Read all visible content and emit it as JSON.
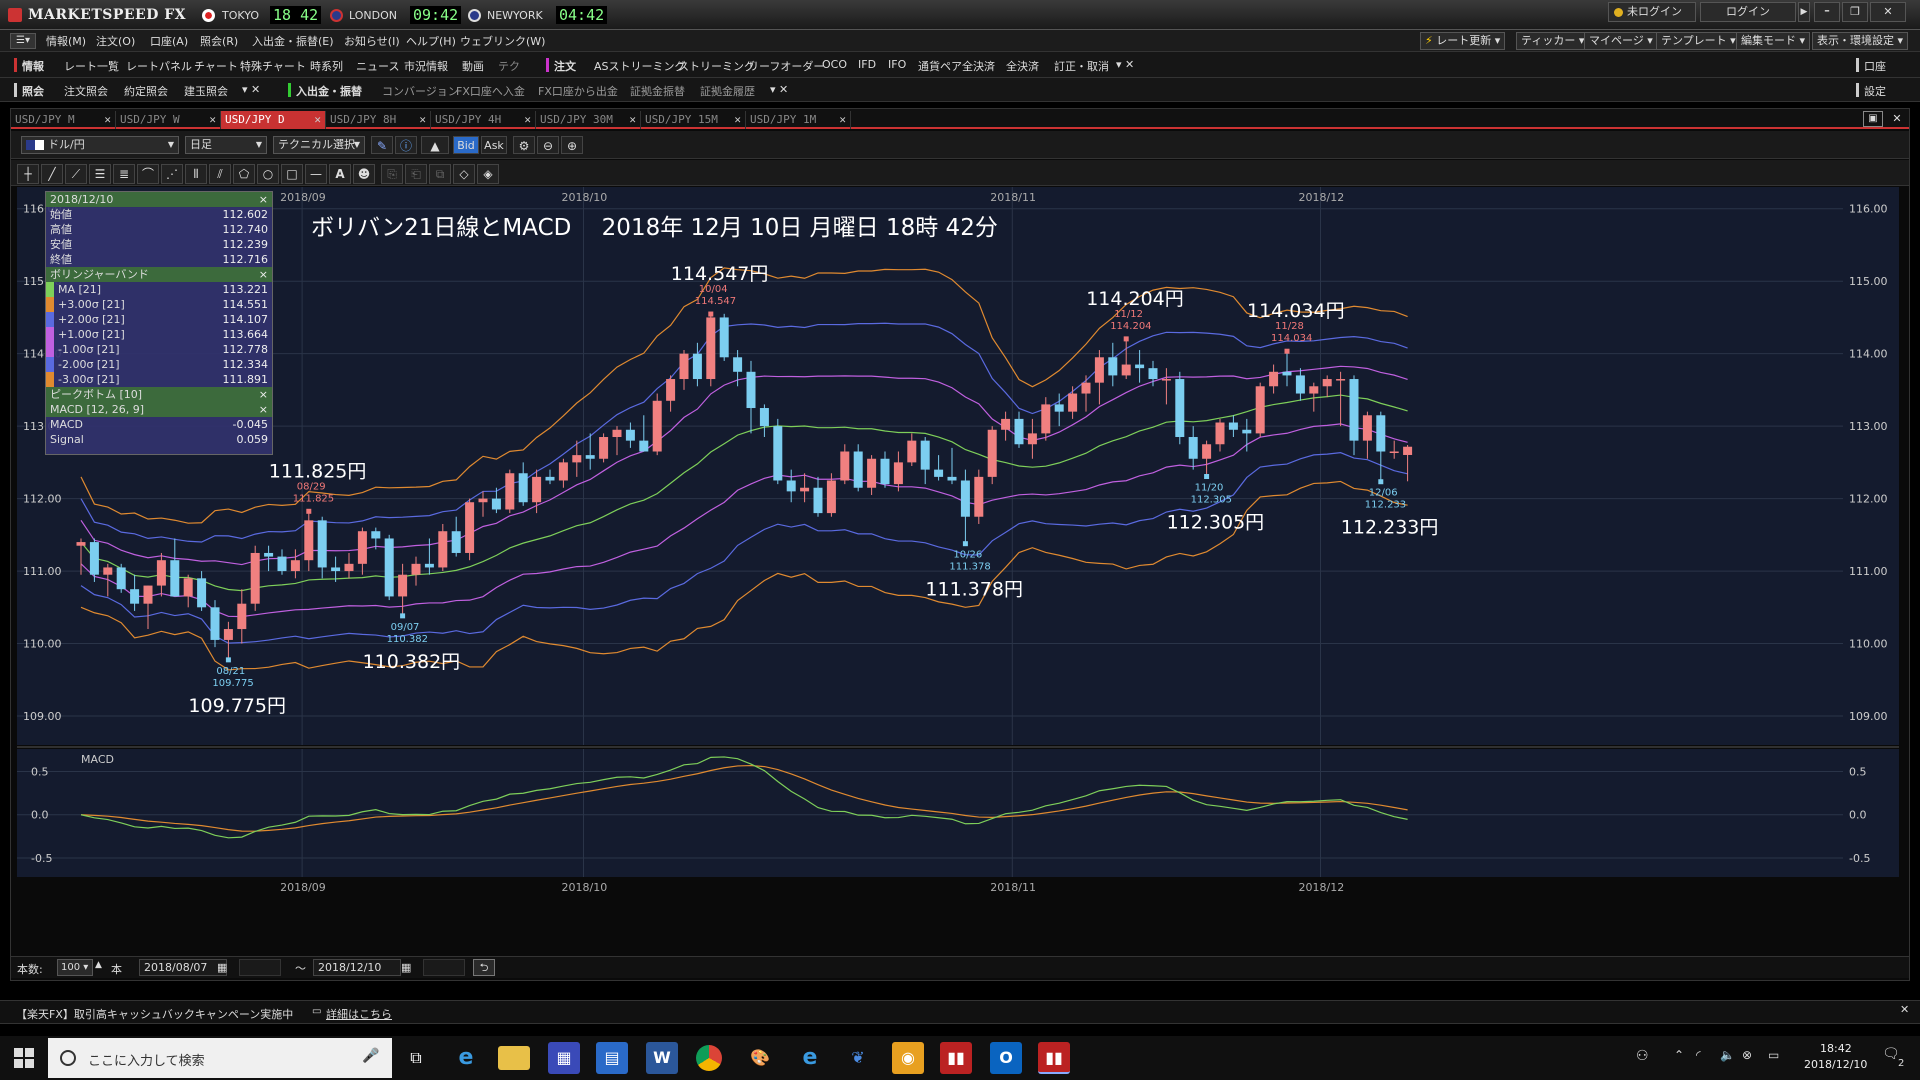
{
  "app": {
    "title": "MARKETSPEED FX",
    "clocks": [
      {
        "city": "TOKYO",
        "time": "18 42"
      },
      {
        "city": "LONDON",
        "time": "09:42"
      },
      {
        "city": "NEWYORK",
        "time": "04:42"
      }
    ],
    "login_status": "未ログイン",
    "login_button": "ログイン"
  },
  "menubar": {
    "items": [
      "情報(M)",
      "注文(O)",
      "口座(A)",
      "照会(R)",
      "入出金・振替(E)",
      "お知らせ(I)",
      "ヘルプ(H)",
      "ウェブリンク(W)"
    ],
    "right_items": [
      "レート更新",
      "ティッカー",
      "マイページ",
      "テンプレート",
      "編集モード",
      "表示・環境設定"
    ]
  },
  "toolbar1": {
    "left_label": "情報",
    "items": [
      "レート一覧",
      "レートパネル",
      "チャート",
      "特殊チャート",
      "時系列",
      "ニュース",
      "市況情報",
      "動画",
      "テク"
    ],
    "order_label": "注文",
    "order_items": [
      "ASストリーミング",
      "ストリーミング",
      "リーフオーダー",
      "OCO",
      "IFD",
      "IFO",
      "通貨ペア全決済",
      "全決済",
      "訂正・取消"
    ],
    "right_label": "口座"
  },
  "toolbar2": {
    "left_label": "照会",
    "items": [
      "注文照会",
      "約定照会",
      "建玉照会"
    ],
    "transfer_label": "入出金・振替",
    "transfer_items": [
      "コンバージョン",
      "FX口座へ入金",
      "FX口座から出金",
      "証拠金振替",
      "証拠金履歴"
    ],
    "right_label": "設定"
  },
  "tabs": [
    "USD/JPY M",
    "USD/JPY W",
    "USD/JPY D",
    "USD/JPY 8H",
    "USD/JPY 4H",
    "USD/JPY 30M",
    "USD/JPY 15M",
    "USD/JPY 1M"
  ],
  "active_tab": 2,
  "controls": {
    "pair": "ドル/円",
    "period": "日足",
    "technical": "テクニカル選択",
    "bid": "Bid",
    "ask": "Ask"
  },
  "info_panel": {
    "date": "2018/12/10",
    "ohlc": [
      {
        "label": "始値",
        "value": "112.602"
      },
      {
        "label": "高値",
        "value": "112.740"
      },
      {
        "label": "安値",
        "value": "112.239"
      },
      {
        "label": "終値",
        "value": "112.716"
      }
    ],
    "bb_title": "ボリンジャーバンド",
    "bb": [
      {
        "label": "MA [21]",
        "value": "113.221"
      },
      {
        "label": "+3.00σ [21]",
        "value": "114.551"
      },
      {
        "label": "+2.00σ [21]",
        "value": "114.107"
      },
      {
        "label": "+1.00σ [21]",
        "value": "113.664"
      },
      {
        "label": "-1.00σ [21]",
        "value": "112.778"
      },
      {
        "label": "-2.00σ [21]",
        "value": "112.334"
      },
      {
        "label": "-3.00σ [21]",
        "value": "111.891"
      }
    ],
    "peak_title": "ピークボトム [10]",
    "macd_title": "MACD [12, 26, 9]",
    "macd": [
      {
        "label": "MACD",
        "value": "-0.045"
      },
      {
        "label": "Signal",
        "value": "0.059"
      }
    ]
  },
  "chart_data": {
    "type": "candlestick",
    "title": "ボリバン21日線とMACD　 2018年 12月 10日 月曜日 18時 42分",
    "month_labels": [
      "2018/09",
      "2018/10",
      "2018/11",
      "2018/12"
    ],
    "y_ticks": [
      "116.00",
      "115.00",
      "114.00",
      "113.00",
      "112.00",
      "111.00",
      "110.00",
      "109.00"
    ],
    "ylim": [
      108.6,
      116.3
    ],
    "macd_label": "MACD",
    "macd_ticks": [
      "0.5",
      "0.0",
      "-0.5"
    ],
    "candles": [
      {
        "o": 111.35,
        "h": 111.45,
        "l": 110.95,
        "c": 111.4
      },
      {
        "o": 111.4,
        "h": 111.45,
        "l": 110.85,
        "c": 110.95
      },
      {
        "o": 110.95,
        "h": 111.1,
        "l": 110.65,
        "c": 111.05
      },
      {
        "o": 111.05,
        "h": 111.1,
        "l": 110.7,
        "c": 110.75
      },
      {
        "o": 110.75,
        "h": 110.95,
        "l": 110.45,
        "c": 110.55
      },
      {
        "o": 110.55,
        "h": 110.8,
        "l": 110.2,
        "c": 110.8
      },
      {
        "o": 110.8,
        "h": 111.25,
        "l": 110.65,
        "c": 111.15
      },
      {
        "o": 111.15,
        "h": 111.45,
        "l": 110.8,
        "c": 110.65
      },
      {
        "o": 110.65,
        "h": 110.95,
        "l": 110.5,
        "c": 110.9
      },
      {
        "o": 110.9,
        "h": 111.0,
        "l": 110.45,
        "c": 110.5
      },
      {
        "o": 110.5,
        "h": 110.6,
        "l": 109.95,
        "c": 110.05
      },
      {
        "o": 110.05,
        "h": 110.3,
        "l": 109.775,
        "c": 110.2
      },
      {
        "o": 110.2,
        "h": 110.75,
        "l": 110.0,
        "c": 110.55
      },
      {
        "o": 110.55,
        "h": 111.35,
        "l": 110.45,
        "c": 111.25
      },
      {
        "o": 111.25,
        "h": 111.35,
        "l": 111.0,
        "c": 111.2
      },
      {
        "o": 111.2,
        "h": 111.3,
        "l": 110.95,
        "c": 111.0
      },
      {
        "o": 111.0,
        "h": 111.3,
        "l": 110.9,
        "c": 111.15
      },
      {
        "o": 111.15,
        "h": 111.825,
        "l": 111.0,
        "c": 111.7
      },
      {
        "o": 111.7,
        "h": 111.75,
        "l": 110.9,
        "c": 111.05
      },
      {
        "o": 111.05,
        "h": 111.2,
        "l": 110.85,
        "c": 111.0
      },
      {
        "o": 111.0,
        "h": 111.25,
        "l": 110.9,
        "c": 111.1
      },
      {
        "o": 111.1,
        "h": 111.6,
        "l": 110.95,
        "c": 111.55
      },
      {
        "o": 111.55,
        "h": 111.6,
        "l": 111.3,
        "c": 111.45
      },
      {
        "o": 111.45,
        "h": 111.5,
        "l": 110.6,
        "c": 110.65
      },
      {
        "o": 110.65,
        "h": 111.1,
        "l": 110.382,
        "c": 110.95
      },
      {
        "o": 110.95,
        "h": 111.2,
        "l": 110.8,
        "c": 111.1
      },
      {
        "o": 111.1,
        "h": 111.45,
        "l": 110.95,
        "c": 111.05
      },
      {
        "o": 111.05,
        "h": 111.65,
        "l": 111.0,
        "c": 111.55
      },
      {
        "o": 111.55,
        "h": 111.75,
        "l": 111.2,
        "c": 111.25
      },
      {
        "o": 111.25,
        "h": 112.0,
        "l": 111.15,
        "c": 111.95
      },
      {
        "o": 111.95,
        "h": 112.1,
        "l": 111.75,
        "c": 112.0
      },
      {
        "o": 112.0,
        "h": 112.15,
        "l": 111.8,
        "c": 111.85
      },
      {
        "o": 111.85,
        "h": 112.4,
        "l": 111.8,
        "c": 112.35
      },
      {
        "o": 112.35,
        "h": 112.5,
        "l": 111.9,
        "c": 111.95
      },
      {
        "o": 111.95,
        "h": 112.4,
        "l": 111.8,
        "c": 112.3
      },
      {
        "o": 112.3,
        "h": 112.4,
        "l": 112.2,
        "c": 112.25
      },
      {
        "o": 112.25,
        "h": 112.55,
        "l": 112.15,
        "c": 112.5
      },
      {
        "o": 112.5,
        "h": 112.8,
        "l": 112.3,
        "c": 112.6
      },
      {
        "o": 112.6,
        "h": 112.9,
        "l": 112.4,
        "c": 112.55
      },
      {
        "o": 112.55,
        "h": 112.9,
        "l": 112.5,
        "c": 112.85
      },
      {
        "o": 112.85,
        "h": 113.0,
        "l": 112.6,
        "c": 112.95
      },
      {
        "o": 112.95,
        "h": 113.05,
        "l": 112.7,
        "c": 112.8
      },
      {
        "o": 112.8,
        "h": 113.15,
        "l": 112.7,
        "c": 112.65
      },
      {
        "o": 112.65,
        "h": 113.45,
        "l": 112.6,
        "c": 113.35
      },
      {
        "o": 113.35,
        "h": 113.7,
        "l": 113.2,
        "c": 113.65
      },
      {
        "o": 113.65,
        "h": 114.05,
        "l": 113.5,
        "c": 114.0
      },
      {
        "o": 114.0,
        "h": 114.15,
        "l": 113.55,
        "c": 113.65
      },
      {
        "o": 113.65,
        "h": 114.547,
        "l": 113.55,
        "c": 114.5
      },
      {
        "o": 114.5,
        "h": 114.55,
        "l": 113.9,
        "c": 113.95
      },
      {
        "o": 113.95,
        "h": 114.05,
        "l": 113.55,
        "c": 113.75
      },
      {
        "o": 113.75,
        "h": 113.9,
        "l": 112.9,
        "c": 113.25
      },
      {
        "o": 113.25,
        "h": 113.3,
        "l": 112.85,
        "c": 113.0
      },
      {
        "o": 113.0,
        "h": 113.1,
        "l": 112.2,
        "c": 112.25
      },
      {
        "o": 112.25,
        "h": 112.4,
        "l": 111.95,
        "c": 112.1
      },
      {
        "o": 112.1,
        "h": 112.35,
        "l": 111.95,
        "c": 112.15
      },
      {
        "o": 112.15,
        "h": 112.3,
        "l": 111.75,
        "c": 111.8
      },
      {
        "o": 111.8,
        "h": 112.35,
        "l": 111.75,
        "c": 112.25
      },
      {
        "o": 112.25,
        "h": 112.75,
        "l": 112.2,
        "c": 112.65
      },
      {
        "o": 112.65,
        "h": 112.75,
        "l": 112.1,
        "c": 112.15
      },
      {
        "o": 112.15,
        "h": 112.6,
        "l": 112.05,
        "c": 112.55
      },
      {
        "o": 112.55,
        "h": 112.65,
        "l": 112.15,
        "c": 112.2
      },
      {
        "o": 112.2,
        "h": 112.65,
        "l": 112.1,
        "c": 112.5
      },
      {
        "o": 112.5,
        "h": 112.9,
        "l": 112.45,
        "c": 112.8
      },
      {
        "o": 112.8,
        "h": 112.85,
        "l": 112.2,
        "c": 112.4
      },
      {
        "o": 112.4,
        "h": 112.6,
        "l": 112.25,
        "c": 112.3
      },
      {
        "o": 112.3,
        "h": 112.7,
        "l": 112.2,
        "c": 112.25
      },
      {
        "o": 112.25,
        "h": 112.4,
        "l": 111.378,
        "c": 111.75
      },
      {
        "o": 111.75,
        "h": 112.4,
        "l": 111.65,
        "c": 112.3
      },
      {
        "o": 112.3,
        "h": 113.0,
        "l": 112.2,
        "c": 112.95
      },
      {
        "o": 112.95,
        "h": 113.2,
        "l": 112.8,
        "c": 113.1
      },
      {
        "o": 113.1,
        "h": 113.2,
        "l": 112.7,
        "c": 112.75
      },
      {
        "o": 112.75,
        "h": 113.1,
        "l": 112.55,
        "c": 112.9
      },
      {
        "o": 112.9,
        "h": 113.4,
        "l": 112.8,
        "c": 113.3
      },
      {
        "o": 113.3,
        "h": 113.45,
        "l": 113.0,
        "c": 113.2
      },
      {
        "o": 113.2,
        "h": 113.55,
        "l": 113.1,
        "c": 113.45
      },
      {
        "o": 113.45,
        "h": 113.7,
        "l": 113.2,
        "c": 113.6
      },
      {
        "o": 113.6,
        "h": 114.05,
        "l": 113.3,
        "c": 113.95
      },
      {
        "o": 113.95,
        "h": 114.15,
        "l": 113.55,
        "c": 113.7
      },
      {
        "o": 113.7,
        "h": 114.204,
        "l": 113.65,
        "c": 113.85
      },
      {
        "o": 113.85,
        "h": 114.05,
        "l": 113.6,
        "c": 113.8
      },
      {
        "o": 113.8,
        "h": 113.9,
        "l": 113.55,
        "c": 113.65
      },
      {
        "o": 113.65,
        "h": 113.8,
        "l": 113.3,
        "c": 113.65
      },
      {
        "o": 113.65,
        "h": 113.75,
        "l": 112.75,
        "c": 112.85
      },
      {
        "o": 112.85,
        "h": 113.0,
        "l": 112.4,
        "c": 112.55
      },
      {
        "o": 112.55,
        "h": 112.8,
        "l": 112.305,
        "c": 112.75
      },
      {
        "o": 112.75,
        "h": 113.1,
        "l": 112.65,
        "c": 113.05
      },
      {
        "o": 113.05,
        "h": 113.15,
        "l": 112.85,
        "c": 112.95
      },
      {
        "o": 112.95,
        "h": 113.1,
        "l": 112.65,
        "c": 112.9
      },
      {
        "o": 112.9,
        "h": 113.6,
        "l": 112.85,
        "c": 113.55
      },
      {
        "o": 113.55,
        "h": 113.85,
        "l": 113.45,
        "c": 113.75
      },
      {
        "o": 113.75,
        "h": 114.034,
        "l": 113.55,
        "c": 113.7
      },
      {
        "o": 113.7,
        "h": 113.8,
        "l": 113.35,
        "c": 113.45
      },
      {
        "o": 113.45,
        "h": 113.6,
        "l": 113.2,
        "c": 113.55
      },
      {
        "o": 113.55,
        "h": 113.7,
        "l": 113.4,
        "c": 113.65
      },
      {
        "o": 113.65,
        "h": 113.75,
        "l": 113.0,
        "c": 113.65
      },
      {
        "o": 113.65,
        "h": 113.7,
        "l": 112.6,
        "c": 112.8
      },
      {
        "o": 112.8,
        "h": 113.2,
        "l": 112.55,
        "c": 113.15
      },
      {
        "o": 113.15,
        "h": 113.2,
        "l": 112.233,
        "c": 112.65
      },
      {
        "o": 112.65,
        "h": 112.8,
        "l": 112.55,
        "c": 112.65
      },
      {
        "o": 112.602,
        "h": 112.74,
        "l": 112.239,
        "c": 112.716
      }
    ],
    "peaks": [
      {
        "date": "08/21",
        "value": "109.775",
        "big": "109.775円",
        "kind": "low",
        "index": 11
      },
      {
        "date": "08/29",
        "value": "111.825",
        "big": "111.825円",
        "kind": "high",
        "index": 17
      },
      {
        "date": "09/07",
        "value": "110.382",
        "big": "110.382円",
        "kind": "low",
        "index": 24
      },
      {
        "date": "10/04",
        "value": "114.547",
        "big": "114.547円",
        "kind": "high",
        "index": 47
      },
      {
        "date": "10/26",
        "value": "111.378",
        "big": "111.378円",
        "kind": "low",
        "index": 66
      },
      {
        "date": "11/12",
        "value": "114.204",
        "big": "114.204円",
        "kind": "high",
        "index": 78
      },
      {
        "date": "11/20",
        "value": "112.305",
        "big": "112.305円",
        "kind": "low",
        "index": 84
      },
      {
        "date": "11/28",
        "value": "114.034",
        "big": "114.034円",
        "kind": "high",
        "index": 90
      },
      {
        "date": "12/06",
        "value": "112.233",
        "big": "112.233円",
        "kind": "low",
        "index": 97
      }
    ],
    "month_index": [
      16,
      37,
      69,
      92
    ]
  },
  "bottom": {
    "count_label": "本数:",
    "count_value": "100",
    "count_unit": "本",
    "from_date": "2018/08/07",
    "tilde": "〜",
    "to_date": "2018/12/10"
  },
  "news": {
    "text": "【楽天FX】取引高キャッシュバックキャンペーン実施中",
    "link": "詳細はこちら"
  },
  "taskbar": {
    "search_placeholder": "ここに入力して検索",
    "time": "18:42",
    "date": "2018/12/10",
    "notification_count": "2"
  },
  "colors": {
    "up": "#f08080",
    "down": "#7ccef0",
    "ma": "#7ecf5a",
    "sigma1": "#c060e0",
    "sigma2": "#5a6ae0",
    "sigma3": "#e08a30",
    "grid": "#2a3448",
    "chart_bg": "#141b2e"
  }
}
